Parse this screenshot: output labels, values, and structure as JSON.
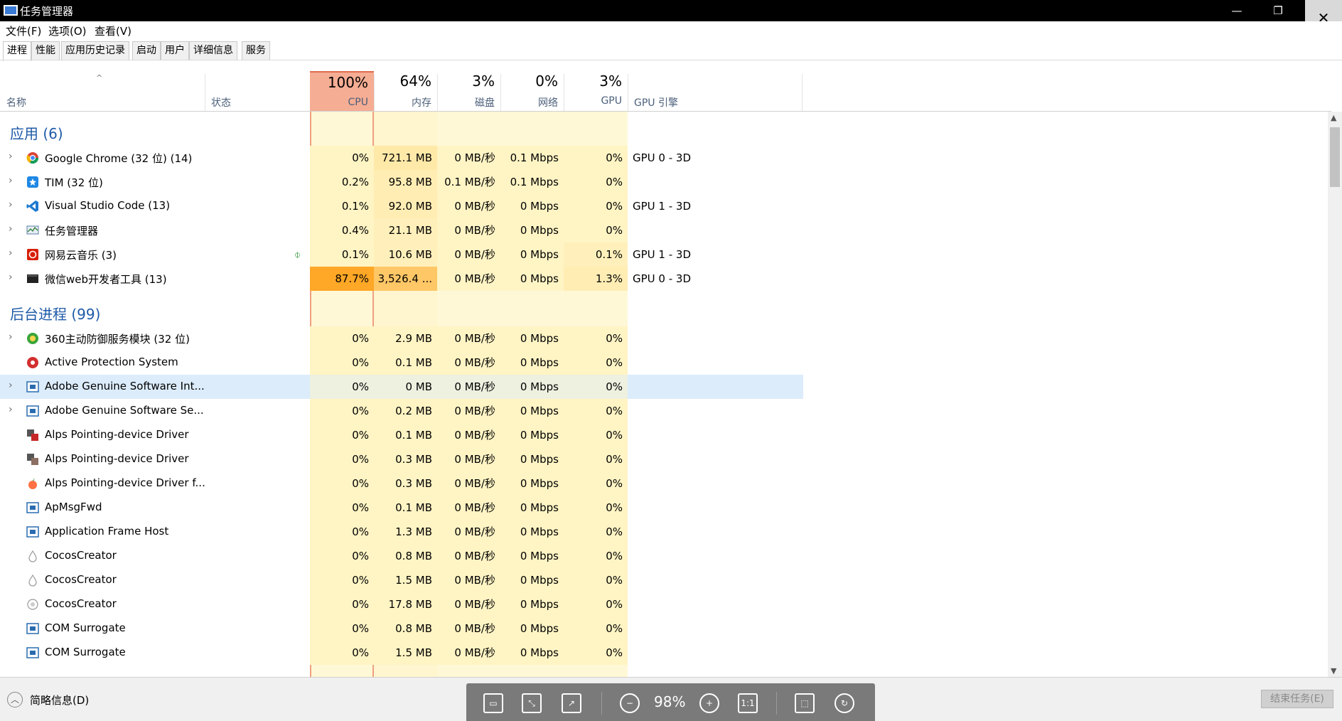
{
  "window": {
    "title": "任务管理器",
    "minimize": "—",
    "maximize": "❐",
    "close": "✕"
  },
  "menu": [
    "文件(F)",
    "选项(O)",
    "查看(V)"
  ],
  "tabs": [
    "进程",
    "性能",
    "应用历史记录",
    "启动",
    "用户",
    "详细信息",
    "服务"
  ],
  "header": {
    "name": "名称",
    "status": "状态",
    "cpu_pct": "100%",
    "cpu": "CPU",
    "mem_pct": "64%",
    "mem": "内存",
    "disk_pct": "3%",
    "disk": "磁盘",
    "net_pct": "0%",
    "net": "网络",
    "gpu_pct": "3%",
    "gpu": "GPU",
    "gpu_engine": "GPU 引擎",
    "sort_arrow": "^"
  },
  "groups": {
    "apps": "应用 (6)",
    "background": "后台进程 (99)"
  },
  "apps": [
    {
      "name": "Google Chrome (32 位) (14)",
      "cpu": "0%",
      "mem": "721.1 MB",
      "disk": "0 MB/秒",
      "net": "0.1 Mbps",
      "gpu": "0%",
      "engine": "GPU 0 - 3D"
    },
    {
      "name": "TIM (32 位)",
      "cpu": "0.2%",
      "mem": "95.8 MB",
      "disk": "0.1 MB/秒",
      "net": "0.1 Mbps",
      "gpu": "0%",
      "engine": ""
    },
    {
      "name": "Visual Studio Code (13)",
      "cpu": "0.1%",
      "mem": "92.0 MB",
      "disk": "0 MB/秒",
      "net": "0 Mbps",
      "gpu": "0%",
      "engine": "GPU 1 - 3D"
    },
    {
      "name": "任务管理器",
      "cpu": "0.4%",
      "mem": "21.1 MB",
      "disk": "0 MB/秒",
      "net": "0 Mbps",
      "gpu": "0%",
      "engine": ""
    },
    {
      "name": "网易云音乐 (3)",
      "cpu": "0.1%",
      "mem": "10.6 MB",
      "disk": "0 MB/秒",
      "net": "0 Mbps",
      "gpu": "0.1%",
      "engine": "GPU 1 - 3D"
    },
    {
      "name": "微信web开发者工具 (13)",
      "cpu": "87.7%",
      "mem": "3,526.4 ...",
      "disk": "0 MB/秒",
      "net": "0 Mbps",
      "gpu": "1.3%",
      "engine": "GPU 0 - 3D"
    }
  ],
  "background": [
    {
      "name": "360主动防御服务模块 (32 位)",
      "cpu": "0%",
      "mem": "2.9 MB",
      "disk": "0 MB/秒",
      "net": "0 Mbps",
      "gpu": "0%"
    },
    {
      "name": "Active Protection System",
      "cpu": "0%",
      "mem": "0.1 MB",
      "disk": "0 MB/秒",
      "net": "0 Mbps",
      "gpu": "0%"
    },
    {
      "name": "Adobe Genuine Software Int...",
      "cpu": "0%",
      "mem": "0 MB",
      "disk": "0 MB/秒",
      "net": "0 Mbps",
      "gpu": "0%"
    },
    {
      "name": "Adobe Genuine Software Se...",
      "cpu": "0%",
      "mem": "0.2 MB",
      "disk": "0 MB/秒",
      "net": "0 Mbps",
      "gpu": "0%"
    },
    {
      "name": "Alps Pointing-device Driver",
      "cpu": "0%",
      "mem": "0.1 MB",
      "disk": "0 MB/秒",
      "net": "0 Mbps",
      "gpu": "0%"
    },
    {
      "name": "Alps Pointing-device Driver",
      "cpu": "0%",
      "mem": "0.3 MB",
      "disk": "0 MB/秒",
      "net": "0 Mbps",
      "gpu": "0%"
    },
    {
      "name": "Alps Pointing-device Driver f...",
      "cpu": "0%",
      "mem": "0.3 MB",
      "disk": "0 MB/秒",
      "net": "0 Mbps",
      "gpu": "0%"
    },
    {
      "name": "ApMsgFwd",
      "cpu": "0%",
      "mem": "0.1 MB",
      "disk": "0 MB/秒",
      "net": "0 Mbps",
      "gpu": "0%"
    },
    {
      "name": "Application Frame Host",
      "cpu": "0%",
      "mem": "1.3 MB",
      "disk": "0 MB/秒",
      "net": "0 Mbps",
      "gpu": "0%"
    },
    {
      "name": "CocosCreator",
      "cpu": "0%",
      "mem": "0.8 MB",
      "disk": "0 MB/秒",
      "net": "0 Mbps",
      "gpu": "0%"
    },
    {
      "name": "CocosCreator",
      "cpu": "0%",
      "mem": "1.5 MB",
      "disk": "0 MB/秒",
      "net": "0 Mbps",
      "gpu": "0%"
    },
    {
      "name": "CocosCreator",
      "cpu": "0%",
      "mem": "17.8 MB",
      "disk": "0 MB/秒",
      "net": "0 Mbps",
      "gpu": "0%"
    },
    {
      "name": "COM Surrogate",
      "cpu": "0%",
      "mem": "0.8 MB",
      "disk": "0 MB/秒",
      "net": "0 Mbps",
      "gpu": "0%"
    },
    {
      "name": "COM Surrogate",
      "cpu": "0%",
      "mem": "1.5 MB",
      "disk": "0 MB/秒",
      "net": "0 Mbps",
      "gpu": "0%"
    }
  ],
  "footer": {
    "fewer_details": "简略信息(D)",
    "end_task": "结束任务(E)"
  },
  "viewer": {
    "zoom": "98%",
    "one_to_one": "1:1"
  },
  "colors": {
    "cpu_header": "#f5ad94",
    "cell_light": "#fff4c4",
    "cell_mid": "#ffe9a8",
    "cell_hot": "#ffa726",
    "selected_row": "#dcecfb",
    "group_title": "#1e5aa8"
  }
}
